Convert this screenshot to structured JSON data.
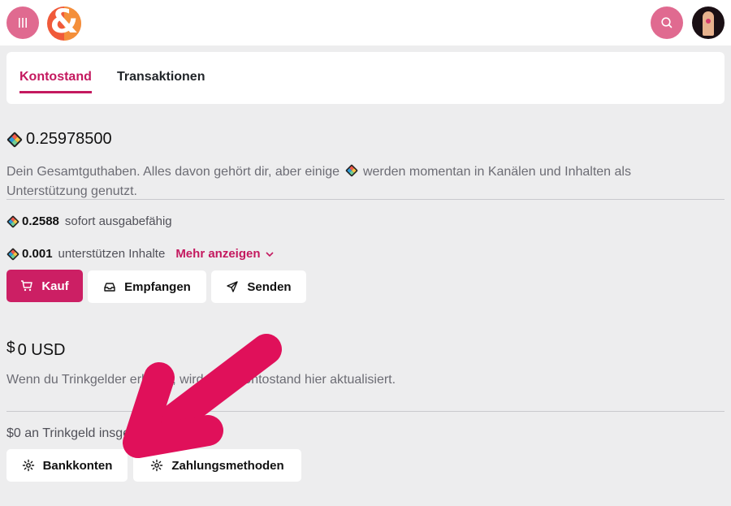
{
  "header": {
    "menu_icon": "menu-icon",
    "logo_icon": "odysee-logo",
    "search_icon": "search-icon",
    "avatar_icon": "avatar"
  },
  "tabs": [
    {
      "label": "Kontostand",
      "active": true
    },
    {
      "label": "Transaktionen",
      "active": false
    }
  ],
  "wallet": {
    "total_balance": "0.25978500",
    "description_part1": "Dein Gesamtguthaben. Alles davon gehört dir, aber einige",
    "description_part2": "werden momentan in Kanälen und Inhalten als Unterstützung genutzt.",
    "spendable_amount": "0.2588",
    "spendable_label": "sofort ausgabefähig",
    "supporting_amount": "0.001",
    "supporting_label": "unterstützen Inhalte",
    "more_label": "Mehr anzeigen",
    "buttons": {
      "buy": "Kauf",
      "receive": "Empfangen",
      "send": "Senden"
    }
  },
  "usd": {
    "currency_symbol": "$",
    "balance": "0 USD",
    "note": "Wenn du Trinkgelder erhältst, wird dein Kontostand hier aktualisiert.",
    "tips_total": "$0 an Trinkgeld insgesamt erhalten",
    "buttons": {
      "bank_accounts": "Bankkonten",
      "payment_methods": "Zahlungsmethoden"
    }
  },
  "colors": {
    "accent": "#c4195f",
    "primary_button": "#cc1f64",
    "arrow": "#e0105a",
    "background": "#ededee"
  }
}
